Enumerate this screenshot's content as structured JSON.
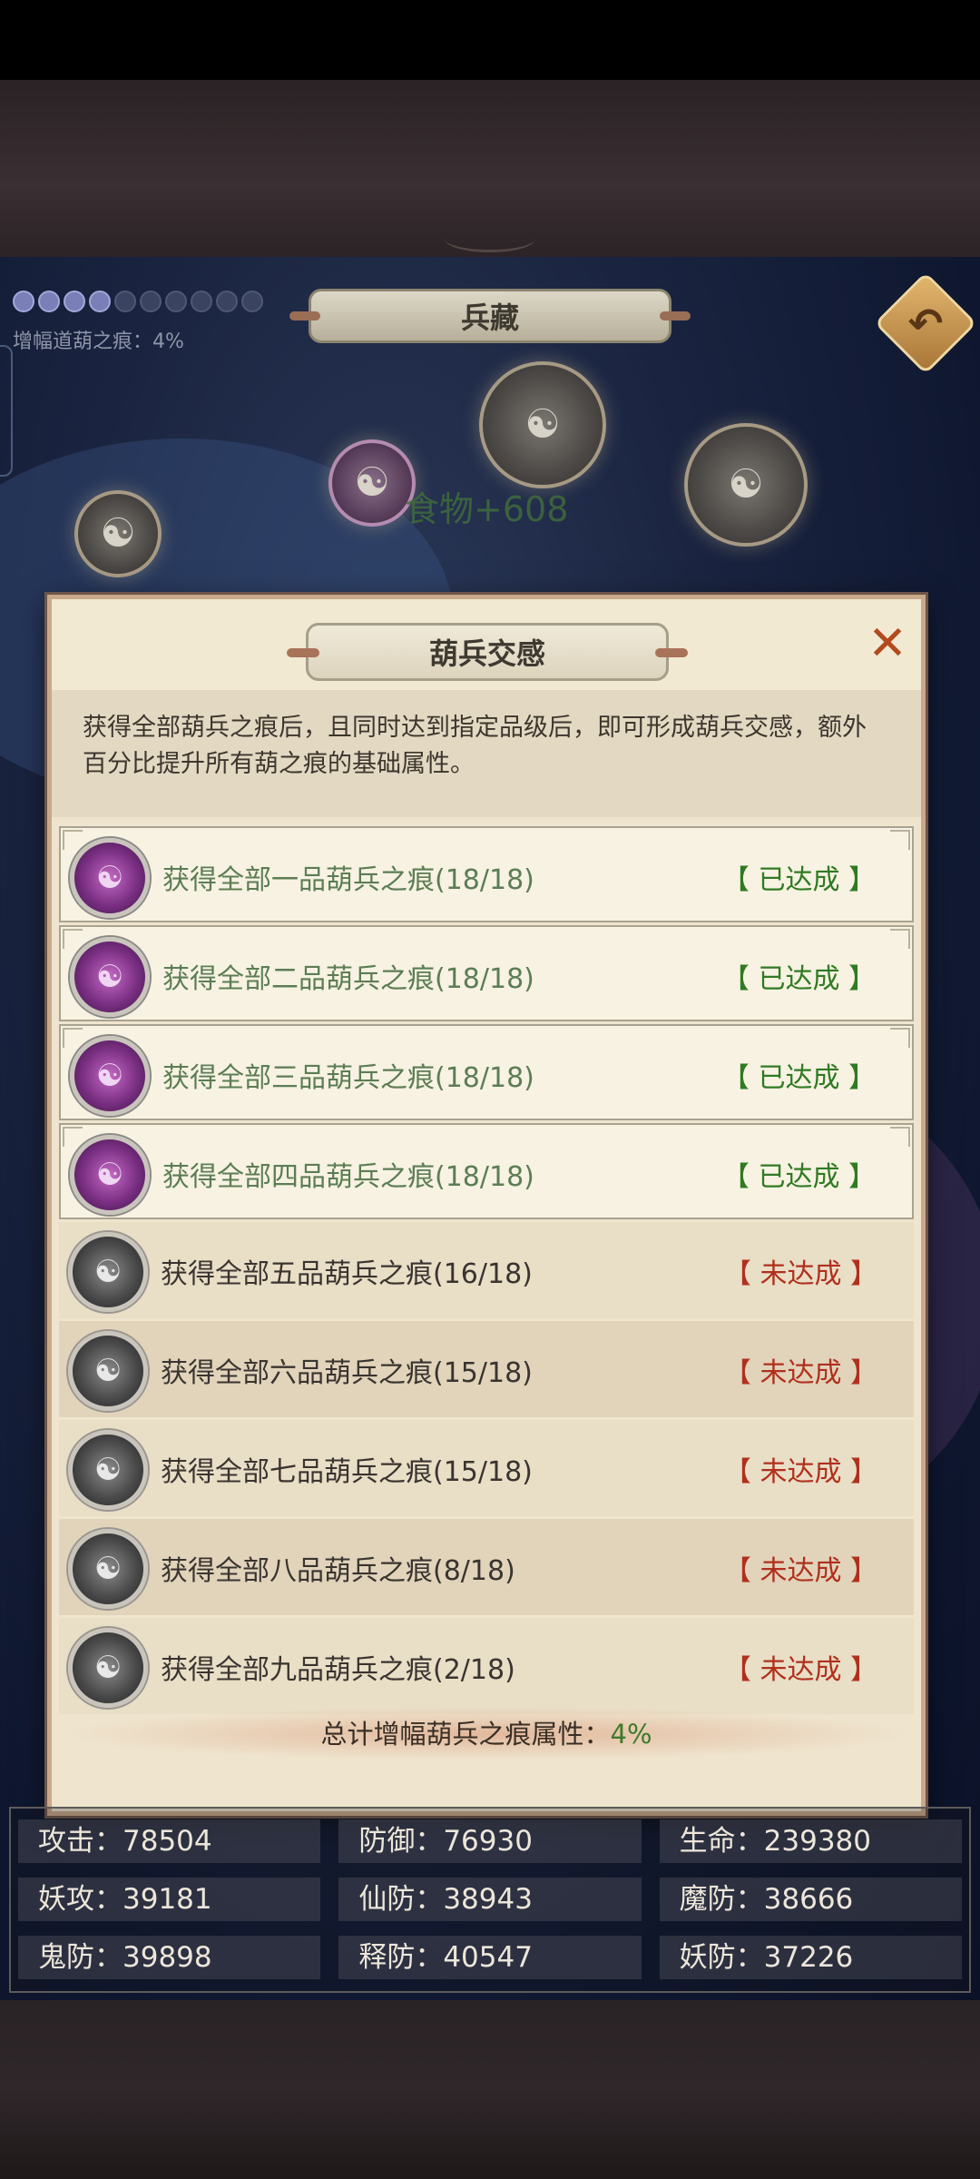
{
  "header": {
    "title": "兵藏",
    "boost_text": "增幅道葫之痕：4%",
    "dots_total": 10,
    "dots_on": 4
  },
  "scene": {
    "floating_text": "食物+608"
  },
  "modal": {
    "title": "葫兵交感",
    "description": "获得全部葫兵之痕后，且同时达到指定品级后，即可形成葫兵交感，额外百分比提升所有葫之痕的基础属性。",
    "rows": [
      {
        "label": "获得全部一品葫兵之痕(18/18)",
        "status": "【 已达成 】",
        "done": true
      },
      {
        "label": "获得全部二品葫兵之痕(18/18)",
        "status": "【 已达成 】",
        "done": true
      },
      {
        "label": "获得全部三品葫兵之痕(18/18)",
        "status": "【 已达成 】",
        "done": true
      },
      {
        "label": "获得全部四品葫兵之痕(18/18)",
        "status": "【 已达成 】",
        "done": true
      },
      {
        "label": "获得全部五品葫兵之痕(16/18)",
        "status": "【 未达成 】",
        "done": false
      },
      {
        "label": "获得全部六品葫兵之痕(15/18)",
        "status": "【 未达成 】",
        "done": false
      },
      {
        "label": "获得全部七品葫兵之痕(15/18)",
        "status": "【 未达成 】",
        "done": false
      },
      {
        "label": "获得全部八品葫兵之痕(8/18)",
        "status": "【 未达成 】",
        "done": false
      },
      {
        "label": "获得全部九品葫兵之痕(2/18)",
        "status": "【 未达成 】",
        "done": false
      }
    ],
    "total_label": "总计增幅葫兵之痕属性：",
    "total_value": "4%"
  },
  "stats": [
    "攻击：78504",
    "防御：76930",
    "生命：239380",
    "妖攻：39181",
    "仙防：38943",
    "魔防：38666",
    "鬼防：39898",
    "释防：40547",
    "妖防：37226"
  ],
  "colors": {
    "done_status": "#2f7a22",
    "todo_status": "#b0301d",
    "done_label": "#5c7d54",
    "close": "#b24a1e"
  }
}
